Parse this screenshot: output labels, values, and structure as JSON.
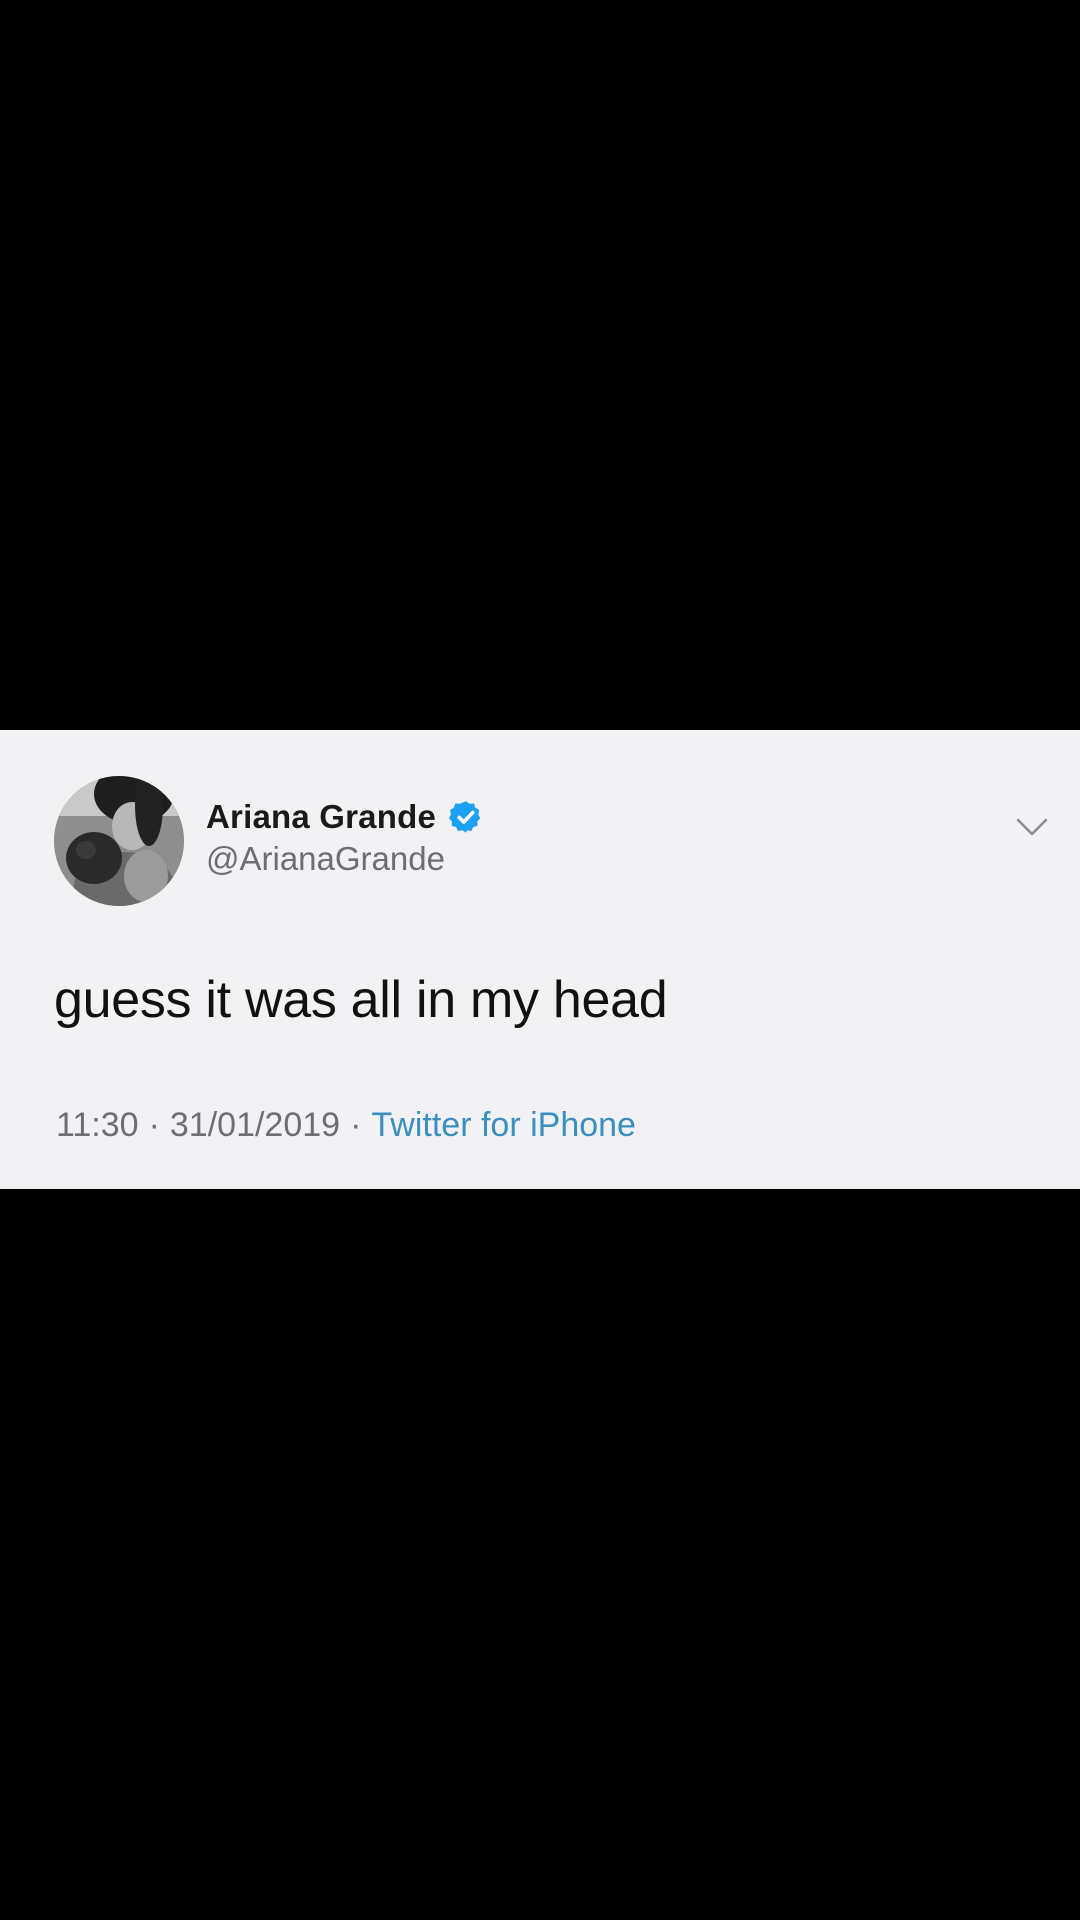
{
  "tweet": {
    "display_name": "Ariana Grande",
    "handle": "@ArianaGrande",
    "verified_icon": "verified-badge-icon",
    "text": "guess it was all in my head",
    "time": "11:30",
    "date": "31/01/2019",
    "separator": "·",
    "source": "Twitter for iPhone",
    "more_icon": "chevron-down-icon"
  },
  "colors": {
    "background": "#000000",
    "card": "#f2f2f4",
    "verified": "#1da1f2",
    "source_link": "#3a8fbf",
    "secondary_text": "#6b6f74"
  }
}
